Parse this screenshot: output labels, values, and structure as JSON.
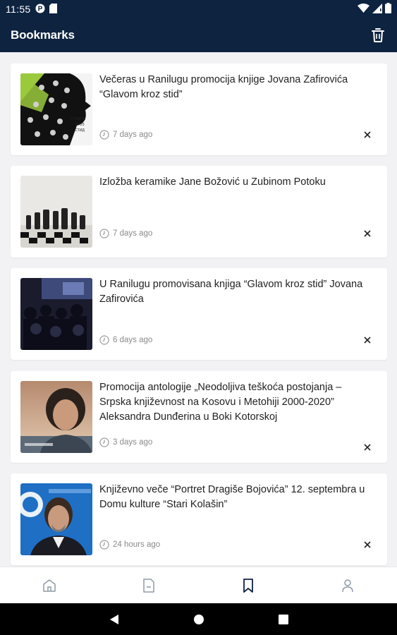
{
  "status_bar": {
    "time": "11:55"
  },
  "app_bar": {
    "title": "Bookmarks"
  },
  "bookmarks": [
    {
      "title": "Večeras u Ranilugu promocija knjige Jovana Zafirovića “Glavom kroz stid”",
      "time_ago": "7 days ago",
      "thumb_text": "ГЛАВОМ КРОЗ СТИД"
    },
    {
      "title": "Izložba keramike Jane Božović u Zubinom Potoku",
      "time_ago": "7 days ago"
    },
    {
      "title": "U Ranilugu promovisana knjiga “Glavom kroz stid” Jovana Zafirovića",
      "time_ago": "6 days ago"
    },
    {
      "title": "Promocija antologije „Neodoljiva teškoća postojanja – Srpska književnost na Kosovu i Metohiji 2000-2020” Aleksandra Dunđerina u Boki Kotorskoj",
      "time_ago": "3 days ago"
    },
    {
      "title": "Književno veče “Portret Dragiše Bojovića” 12. septembra u Domu kulture “Stari Kolašin”",
      "time_ago": "24 hours ago"
    }
  ],
  "colors": {
    "primary": "#0e2340",
    "background": "#f2f2f4",
    "meta": "#8a8a8a"
  }
}
